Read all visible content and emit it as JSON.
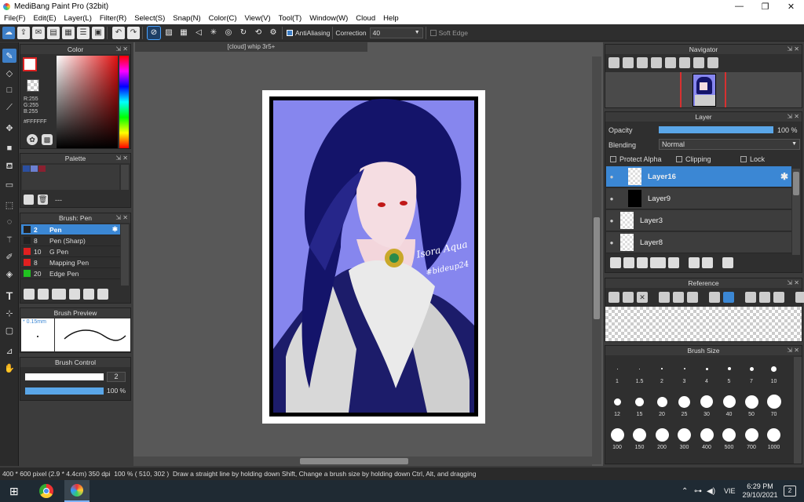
{
  "window": {
    "title": "MediBang Paint Pro (32bit)",
    "minimize": "—",
    "maximize": "❐",
    "close": "✕"
  },
  "menu": [
    "File(F)",
    "Edit(E)",
    "Layer(L)",
    "Filter(R)",
    "Select(S)",
    "Snap(N)",
    "Color(C)",
    "View(V)",
    "Tool(T)",
    "Window(W)",
    "Cloud",
    "Help"
  ],
  "toolbar": {
    "antialiasing_label": "AntiAliasing",
    "correction_label": "Correction",
    "correction_value": "40",
    "soft_edge_label": "Soft Edge"
  },
  "color_panel": {
    "title": "Color",
    "r": "R:255",
    "g": "G:255",
    "b": "B:255",
    "hex": "#FFFFFF"
  },
  "palette_panel": {
    "title": "Palette",
    "add_label": "---",
    "swatches": [
      "#2b4fa0",
      "#6b7fd0",
      "#8a2030"
    ]
  },
  "brush_panel": {
    "title": "Brush: Pen",
    "items": [
      {
        "size": "2",
        "name": "Pen",
        "color": "#222222",
        "selected": true
      },
      {
        "size": "8",
        "name": "Pen (Sharp)",
        "color": "#222222",
        "selected": false
      },
      {
        "size": "10",
        "name": "G Pen",
        "color": "#e02020",
        "selected": false
      },
      {
        "size": "8",
        "name": "Mapping Pen",
        "color": "#e02020",
        "selected": false
      },
      {
        "size": "20",
        "name": "Edge Pen",
        "color": "#20c020",
        "selected": false
      }
    ]
  },
  "brush_preview": {
    "title": "Brush Preview",
    "size_label": "* 0.15mm"
  },
  "brush_control": {
    "title": "Brush Control",
    "size_value": "2",
    "opacity_value": "100 %",
    "opacity": 1.0
  },
  "document": {
    "tab": "[cloud] whip 3r5+"
  },
  "artwork": {
    "signature_1": "Isora Aqua",
    "signature_2": "#bideup24"
  },
  "navigator": {
    "title": "Navigator"
  },
  "layer_panel": {
    "title": "Layer",
    "opacity_label": "Opacity",
    "opacity_value": "100 %",
    "opacity": 1.0,
    "blending_label": "Blending",
    "blending_value": "Normal",
    "protect_alpha": "Protect Alpha",
    "clipping": "Clipping",
    "lock": "Lock",
    "layers": [
      {
        "name": "Layer16",
        "selected": true
      },
      {
        "name": "Layer9",
        "selected": false
      },
      {
        "name": "Layer3",
        "selected": false
      },
      {
        "name": "Layer8",
        "selected": false
      }
    ]
  },
  "reference_panel": {
    "title": "Reference"
  },
  "brush_size_panel": {
    "title": "Brush Size",
    "sizes": [
      "1",
      "1.5",
      "2",
      "3",
      "4",
      "5",
      "7",
      "10",
      "12",
      "15",
      "20",
      "25",
      "30",
      "40",
      "50",
      "70",
      "100",
      "150",
      "200",
      "300",
      "400",
      "500",
      "700",
      "1000"
    ]
  },
  "status": {
    "dimensions": "400 * 600 pixel",
    "physical": "(2.9 * 4.4cm)",
    "dpi": "350 dpi",
    "zoom": "100 %",
    "coords": "( 510, 302 )",
    "hint": "Draw a straight line by holding down Shift, Change a brush size by holding down Ctrl, Alt, and dragging"
  },
  "taskbar": {
    "language": "VIE",
    "time": "6:29 PM",
    "date": "29/10/2021",
    "notifications": "2"
  }
}
